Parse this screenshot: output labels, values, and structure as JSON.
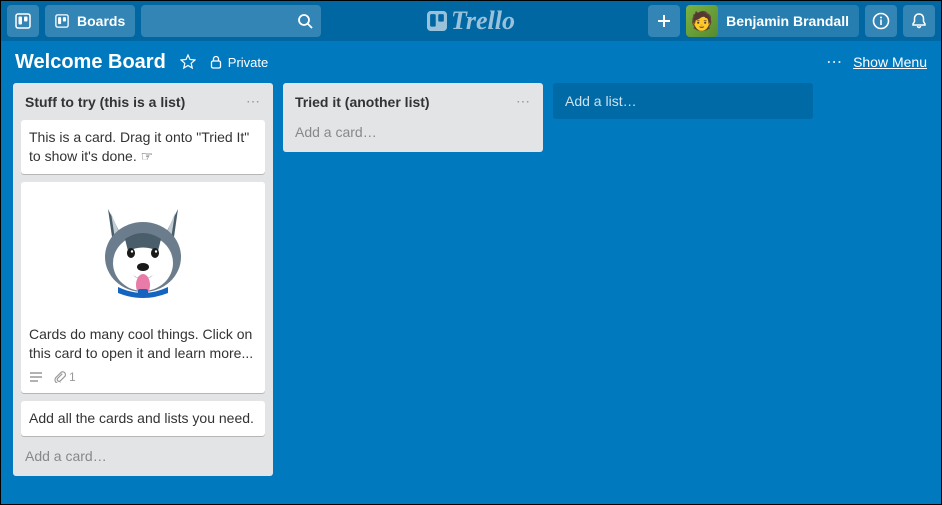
{
  "header": {
    "boards_label": "Boards",
    "logo_text": "Trello",
    "username": "Benjamin Brandall"
  },
  "board": {
    "title": "Welcome Board",
    "privacy_label": "Private",
    "menu_dots": "⋯",
    "show_menu_label": "Show Menu"
  },
  "lists": [
    {
      "title": "Stuff to try (this is a list)",
      "add_card_label": "Add a card…",
      "cards": [
        {
          "text": "This is a card. Drag it onto \"Tried It\" to show it's done. ☞"
        },
        {
          "text": "Cards do many cool things. Click on this card to open it and learn more...",
          "has_cover": true,
          "attachment_count": "1"
        },
        {
          "text": "Add all the cards and lists you need."
        }
      ]
    },
    {
      "title": "Tried it (another list)",
      "add_card_label": "Add a card…",
      "cards": []
    }
  ],
  "add_list_label": "Add a list…"
}
